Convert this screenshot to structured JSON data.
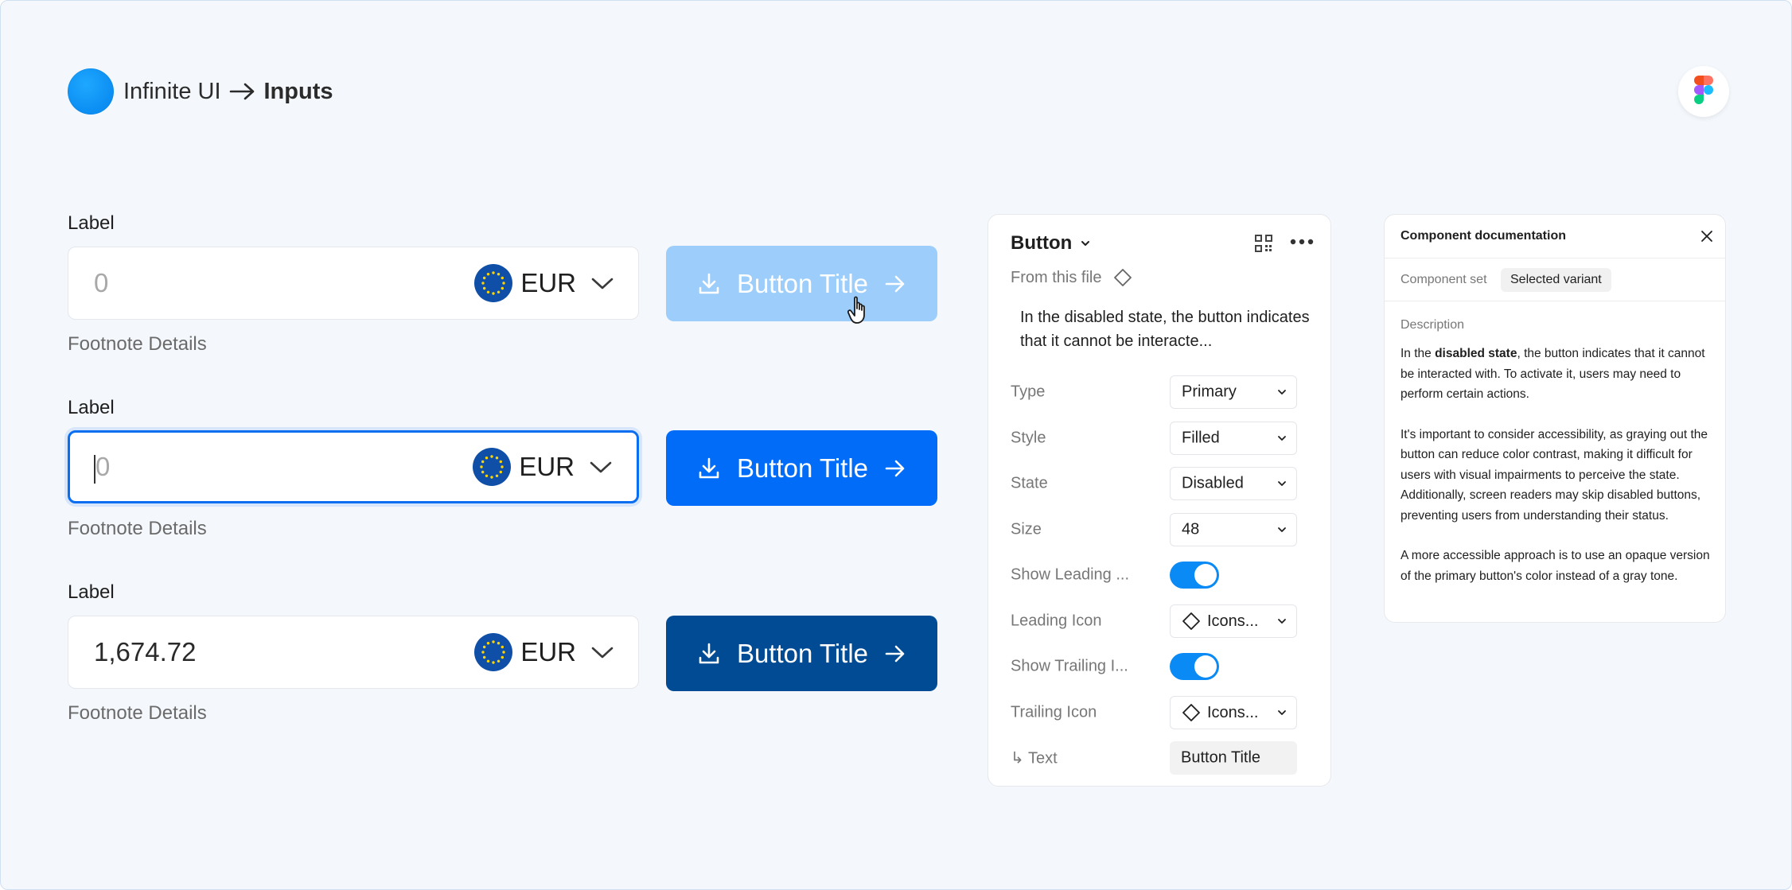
{
  "header": {
    "app_name": "Infinite UI",
    "page_name": "Inputs"
  },
  "form_rows": [
    {
      "label": "Label",
      "value": "0",
      "currency": "EUR",
      "footnote": "Footnote Details",
      "button_label": "Button Title",
      "button_state": "disabled"
    },
    {
      "label": "Label",
      "value": "0",
      "currency": "EUR",
      "footnote": "Footnote Details",
      "button_label": "Button Title",
      "button_state": "default"
    },
    {
      "label": "Label",
      "value": "1,674.72",
      "currency": "EUR",
      "footnote": "Footnote Details",
      "button_label": "Button Title",
      "button_state": "pressed"
    }
  ],
  "properties": {
    "title": "Button",
    "source": "From this file",
    "description": "In the disabled state, the button indicates that it cannot be interacte...",
    "rows": [
      {
        "label": "Type",
        "value": "Primary"
      },
      {
        "label": "Style",
        "value": "Filled"
      },
      {
        "label": "State",
        "value": "Disabled"
      },
      {
        "label": "Size",
        "value": "48"
      },
      {
        "label": "Show Leading ...",
        "toggle": true
      },
      {
        "label": "Leading Icon",
        "value": "Icons..."
      },
      {
        "label": "Show Trailing I...",
        "toggle": true
      },
      {
        "label": "Trailing Icon",
        "value": "Icons..."
      },
      {
        "label": "↳ Text",
        "value": "Button Title"
      }
    ]
  },
  "docs": {
    "title": "Component documentation",
    "tabs": [
      "Component set",
      "Selected variant"
    ],
    "active_tab": "Selected variant",
    "section": "Description",
    "p1_pre": "In the ",
    "p1_bold": "disabled state",
    "p1_post": ", the button indicates that it cannot be interacted with. To activate it, users may need to perform certain actions.",
    "p2": "It's important to consider accessibility, as graying out the button can reduce color contrast, making it difficult for users with visual impairments to perceive the state. Additionally, screen readers may skip disabled buttons, preventing users from understanding their status.",
    "p3": "A more accessible approach is to use an opaque version of the primary button's color instead of a gray tone."
  },
  "colors": {
    "accent": "#006cf8",
    "disabled_button": "#9ccdfb",
    "pressed_button": "#004b93",
    "background": "#f4f8fc",
    "toggle_on": "#0a8af5"
  },
  "icons": [
    "logo-dot",
    "arrow-right-icon",
    "figma-icon",
    "eu-flag-icon",
    "chevron-down-icon",
    "download-icon",
    "cursor-hand-icon",
    "grid-icon",
    "more-icon",
    "component-diamond-icon",
    "close-icon"
  ]
}
